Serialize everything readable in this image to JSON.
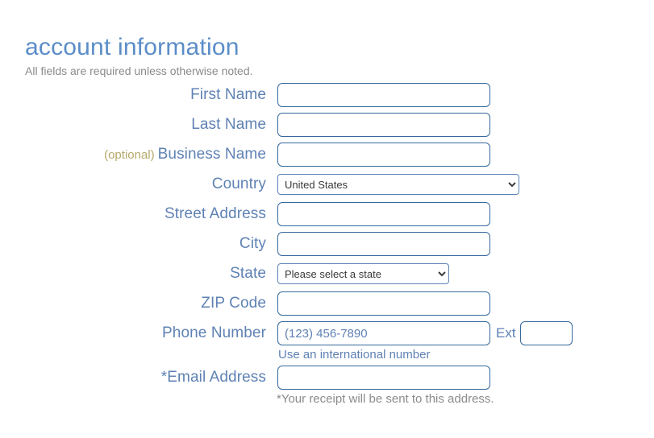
{
  "header": {
    "title": "account information",
    "subtitle": "All fields are required unless otherwise noted."
  },
  "form": {
    "fields": [
      {
        "name": "first-name",
        "label": "First Name",
        "type": "text",
        "value": "",
        "placeholder": ""
      },
      {
        "name": "last-name",
        "label": "Last Name",
        "type": "text",
        "value": "",
        "placeholder": ""
      },
      {
        "name": "business-name",
        "label": "Business Name",
        "optional_tag": "(optional)",
        "type": "text",
        "value": "",
        "placeholder": ""
      },
      {
        "name": "country",
        "label": "Country",
        "type": "select",
        "selected": "United States",
        "options": [
          "United States"
        ]
      },
      {
        "name": "street-address",
        "label": "Street Address",
        "type": "text",
        "value": "",
        "placeholder": ""
      },
      {
        "name": "city",
        "label": "City",
        "type": "text",
        "value": "",
        "placeholder": ""
      },
      {
        "name": "state",
        "label": "State",
        "type": "select",
        "selected": "Please select a state",
        "options": [
          "Please select a state"
        ]
      },
      {
        "name": "zip-code",
        "label": "ZIP Code",
        "type": "text",
        "value": "",
        "placeholder": ""
      },
      {
        "name": "phone-number",
        "label": "Phone Number",
        "type": "phone",
        "value": "",
        "placeholder": "(123) 456-7890",
        "ext_label": "Ext",
        "ext_value": "",
        "helper_link": "Use an international number"
      },
      {
        "name": "email-address",
        "label": "Email Address",
        "required_marker": "*",
        "type": "text",
        "value": "",
        "placeholder": "",
        "helper_note": "*Your receipt will be sent to this address."
      }
    ]
  },
  "colors": {
    "title": "#5b8dc8",
    "label": "#5f82b4",
    "optional": "#b5a96a",
    "border": "#36699c",
    "muted_text": "#8b8b8b",
    "background": "#ffffff"
  }
}
